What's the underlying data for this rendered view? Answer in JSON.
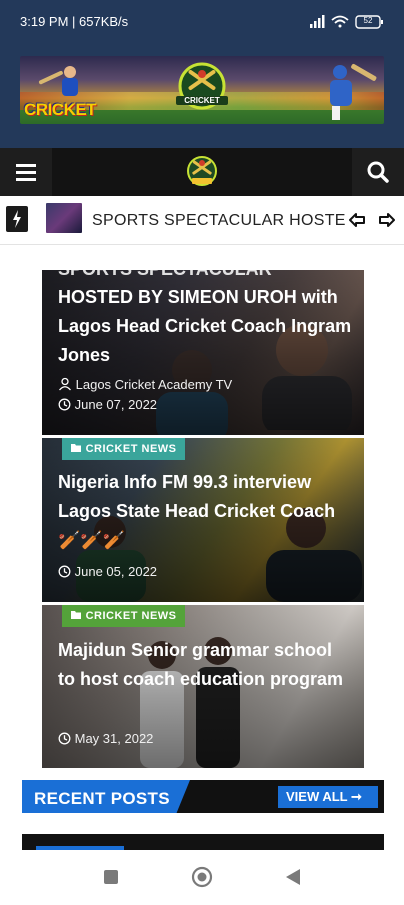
{
  "status_bar": {
    "time_speed": "3:19 PM | 657KB/s",
    "battery": "52"
  },
  "banner": {
    "left_text": "CRICKET",
    "logo_text": "CRICKET"
  },
  "ticker": {
    "text": "SPORTS SPECTACULAR HOSTED BY"
  },
  "cards": [
    {
      "title_top": "SPORTS SPECTACULAR",
      "title": "HOSTED BY SIMEON UROH with Lagos Head Cricket Coach Ingram Jones",
      "author": "Lagos Cricket Academy TV",
      "date": "June 07, 2022"
    },
    {
      "category": "CRICKET NEWS",
      "title": "Nigeria Info FM 99.3 interview Lagos State Head Cricket Coach 🏏🏏🏏",
      "date": "June 05, 2022"
    },
    {
      "category": "CRICKET NEWS",
      "title": "Majidun Senior grammar school to host coach education program",
      "date": "May 31, 2022"
    }
  ],
  "recent_posts": {
    "label": "RECENT POSTS",
    "view_all": "VIEW ALL ➞"
  },
  "colors": {
    "header_bg": "#23395a",
    "nav_bg": "#131313",
    "accent_blue": "#1a6fd6",
    "category_teal": "#3aa59b",
    "category_green": "#54a33a"
  }
}
